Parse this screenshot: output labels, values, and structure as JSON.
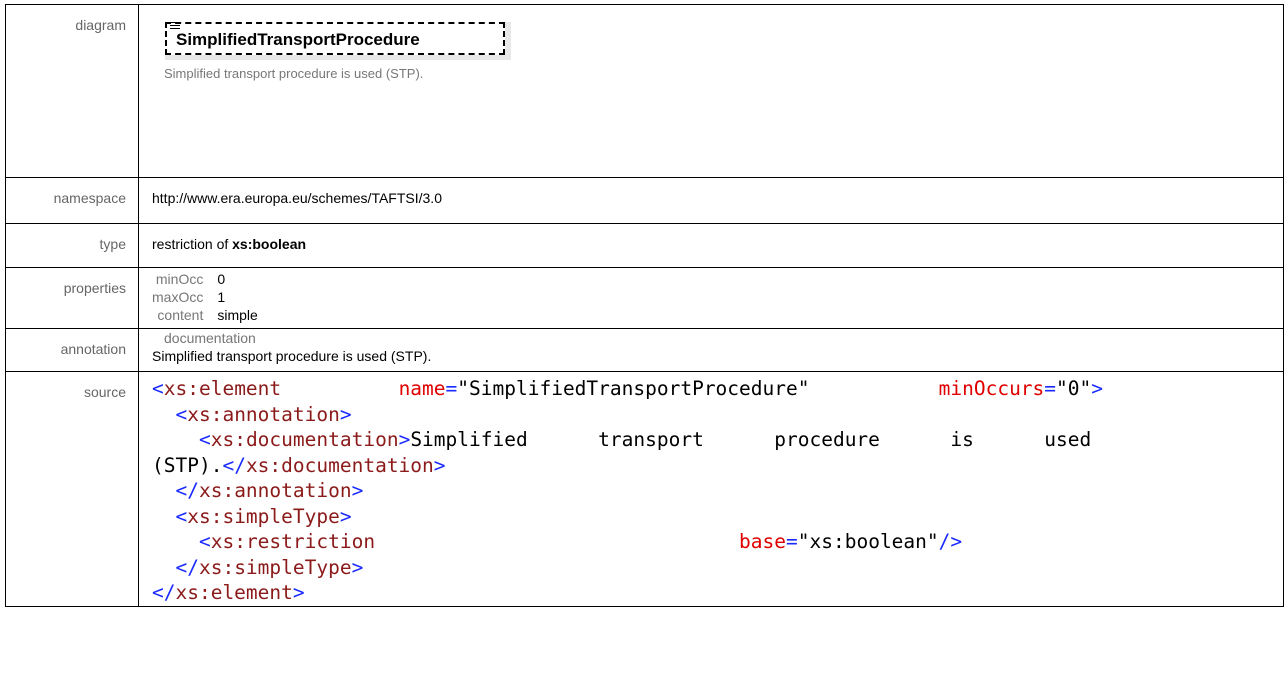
{
  "labels": {
    "diagram": "diagram",
    "namespace": "namespace",
    "type": "type",
    "properties": "properties",
    "annotation": "annotation",
    "source": "source"
  },
  "diagram": {
    "element_name": "SimplifiedTransportProcedure",
    "element_doc": "Simplified transport procedure is used (STP).",
    "icon": "annotation-lines-icon"
  },
  "namespace": "http://www.era.europa.eu/schemes/TAFTSI/3.0",
  "type": {
    "prefix": "restriction of ",
    "base": "xs:boolean"
  },
  "properties": [
    {
      "key": "minOcc",
      "value": "0"
    },
    {
      "key": "maxOcc",
      "value": "1"
    },
    {
      "key": "content",
      "value": "simple"
    }
  ],
  "annotation": {
    "key": "documentation",
    "text": "Simplified transport procedure is used (STP)."
  },
  "source": {
    "lines": [
      "<xs:element name=\"SimplifiedTransportProcedure\" minOccurs=\"0\">",
      "  <xs:annotation>",
      "    <xs:documentation>Simplified transport procedure is used (STP).</xs:documentation>",
      "  </xs:annotation>",
      "  <xs:simpleType>",
      "    <xs:restriction base=\"xs:boolean\"/>",
      "  </xs:simpleType>",
      "</xs:element>"
    ]
  },
  "colors": {
    "tag": "#8b1a1a",
    "bracket": "#1a2aff",
    "attribute": "#e00000",
    "label": "#666666"
  }
}
